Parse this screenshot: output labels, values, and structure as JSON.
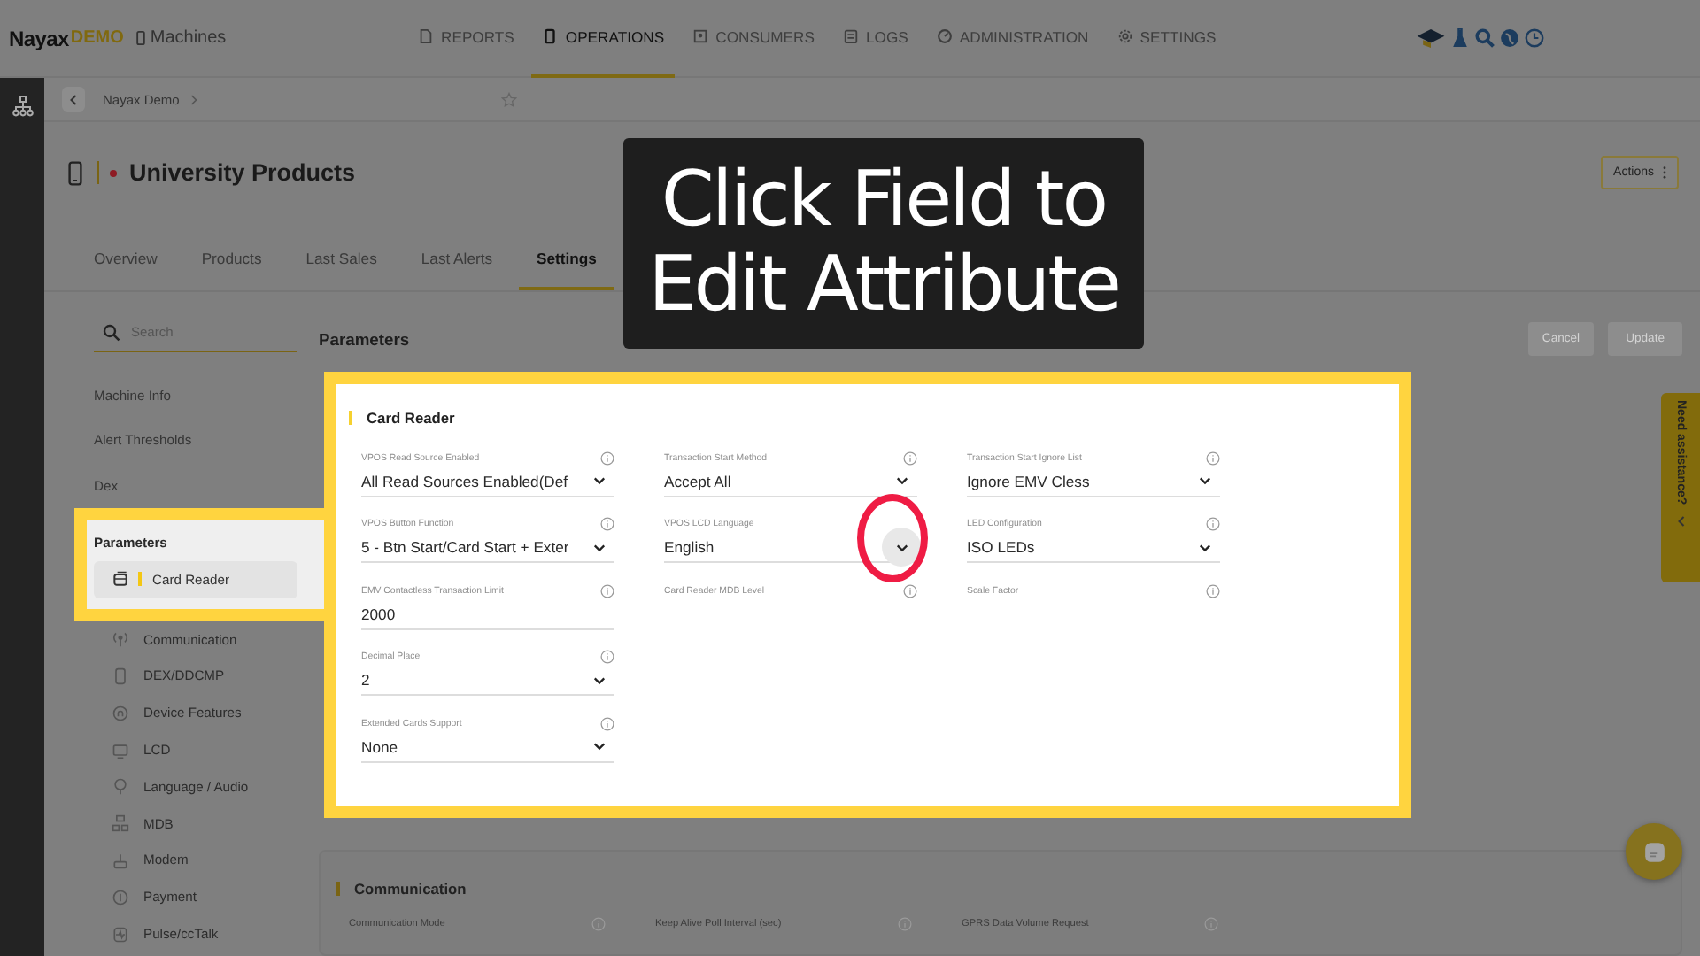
{
  "brand": {
    "name": "Nayax",
    "suffix": "DEMO"
  },
  "module": "Machines",
  "nav": [
    {
      "label": "REPORTS",
      "selected": false
    },
    {
      "label": "OPERATIONS",
      "selected": true
    },
    {
      "label": "CONSUMERS",
      "selected": false
    },
    {
      "label": "LOGS",
      "selected": false
    },
    {
      "label": "ADMINISTRATION",
      "selected": false
    },
    {
      "label": "SETTINGS",
      "selected": false
    }
  ],
  "breadcrumb": [
    "Nayax Demo"
  ],
  "machine": {
    "title": "University Products"
  },
  "actions_button": "Actions",
  "tabs": [
    {
      "label": "Overview",
      "selected": false
    },
    {
      "label": "Products",
      "selected": false
    },
    {
      "label": "Last Sales",
      "selected": false
    },
    {
      "label": "Last Alerts",
      "selected": false
    },
    {
      "label": "Settings",
      "selected": true
    }
  ],
  "search": {
    "placeholder": "Search"
  },
  "side_links": [
    "Machine Info",
    "Alert Thresholds",
    "Dex"
  ],
  "parameters": {
    "heading": "Parameters",
    "items": [
      {
        "label": "Card Reader",
        "selected": true
      },
      {
        "label": "Communication",
        "selected": false
      },
      {
        "label": "DEX/DDCMP",
        "selected": false
      },
      {
        "label": "Device Features",
        "selected": false
      },
      {
        "label": "LCD",
        "selected": false
      },
      {
        "label": "Language / Audio",
        "selected": false
      },
      {
        "label": "MDB",
        "selected": false
      },
      {
        "label": "Modem",
        "selected": false
      },
      {
        "label": "Payment",
        "selected": false
      },
      {
        "label": "Pulse/ccTalk",
        "selected": false
      }
    ]
  },
  "panel": {
    "title": "Parameters",
    "buttons": [
      "Cancel",
      "Update"
    ]
  },
  "card": {
    "title": "Card Reader",
    "columns": [
      [
        {
          "label": "VPOS Read Source Enabled",
          "value": "All Read Sources Enabled(Def",
          "kind": "select",
          "circled": false
        },
        {
          "label": "VPOS Button Function",
          "value": "5 - Btn Start/Card Start + Exter",
          "kind": "select",
          "circled": false
        },
        {
          "label": "EMV Contactless Transaction Limit",
          "value": "2000",
          "kind": "text",
          "circled": false
        },
        {
          "label": "Decimal Place",
          "value": "2",
          "kind": "select",
          "circled": false
        },
        {
          "label": "Extended Cards Support",
          "value": "None",
          "kind": "select",
          "circled": false
        }
      ],
      [
        {
          "label": "Transaction Start Method",
          "value": "Accept All",
          "kind": "select",
          "circled": false
        },
        {
          "label": "VPOS LCD Language",
          "value": "English",
          "kind": "select",
          "circled": true
        },
        {
          "label": "Card Reader MDB Level",
          "kind": "blank"
        }
      ],
      [
        {
          "label": "Transaction Start Ignore List",
          "value": "Ignore EMV Cless",
          "kind": "select",
          "circled": false
        },
        {
          "label": "LED Configuration",
          "value": "ISO LEDs",
          "kind": "select",
          "circled": false
        },
        {
          "label": "Scale Factor",
          "kind": "blank"
        }
      ]
    ]
  },
  "communication": {
    "title": "Communication",
    "fields": [
      "Communication Mode",
      "Keep Alive Poll Interval (sec)",
      "GPRS Data Volume Request"
    ]
  },
  "caption": [
    "Click Field to",
    "Edit Attribute"
  ],
  "assistance_tab": "Need assistance?"
}
